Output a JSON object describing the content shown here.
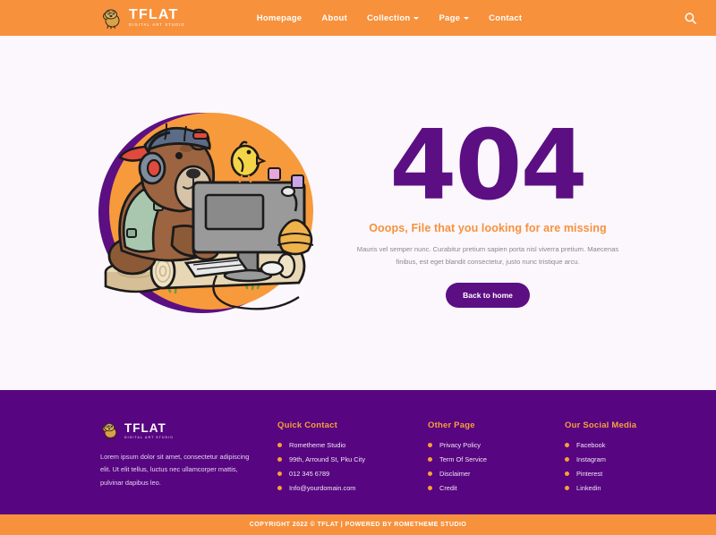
{
  "header": {
    "logo": {
      "name": "TFLAT",
      "tagline": "DIGITAL ART STUDIO",
      "icon": "bear-mascot-icon"
    },
    "nav": [
      {
        "label": "Homepage",
        "has_dropdown": false
      },
      {
        "label": "About",
        "has_dropdown": false
      },
      {
        "label": "Collection",
        "has_dropdown": true
      },
      {
        "label": "Page",
        "has_dropdown": true
      },
      {
        "label": "Contact",
        "has_dropdown": false
      }
    ],
    "search_icon": "search-icon",
    "background": "#F7913C"
  },
  "main": {
    "illustration": "bear-at-computer-illustration",
    "error_code": "404",
    "tagline": "Ooops, File that you looking for are missing",
    "description": "Mauris vel semper nunc. Curabitur pretium sapien porta nisl viverra pretium. Maecenas finibus, est eget blandit consectetur, justo nunc tristique arcu.",
    "button_label": "Back to home",
    "accent_purple": "#5C0F82",
    "accent_orange": "#F7913C"
  },
  "footer": {
    "logo": {
      "name": "TFLAT",
      "tagline": "DIGITAL ART STUDIO"
    },
    "description": "Lorem ipsum dolor sit amet, consectetur adipiscing elit. Ut elit tellus, luctus nec ullamcorper mattis, pulvinar dapibus leo.",
    "columns": [
      {
        "title": "Quick Contact",
        "items": [
          "Rometheme Studio",
          "99th, Arround St, Pku City",
          "012 345 6789",
          "Info@yourdomain.com"
        ]
      },
      {
        "title": "Other Page",
        "items": [
          "Privacy Policy",
          "Term Of Service",
          "Disclaimer",
          "Credit"
        ]
      },
      {
        "title": "Our Social Media",
        "items": [
          "Facebook",
          "Instagram",
          "Pinterest",
          "Linkedin"
        ]
      }
    ],
    "background": "#570580",
    "title_color": "#F7A139"
  },
  "copyright": {
    "text": "COPYRIGHT 2022 © TFLAT | POWERED BY ROMETHEME STUDIO",
    "background": "#F7913C"
  }
}
